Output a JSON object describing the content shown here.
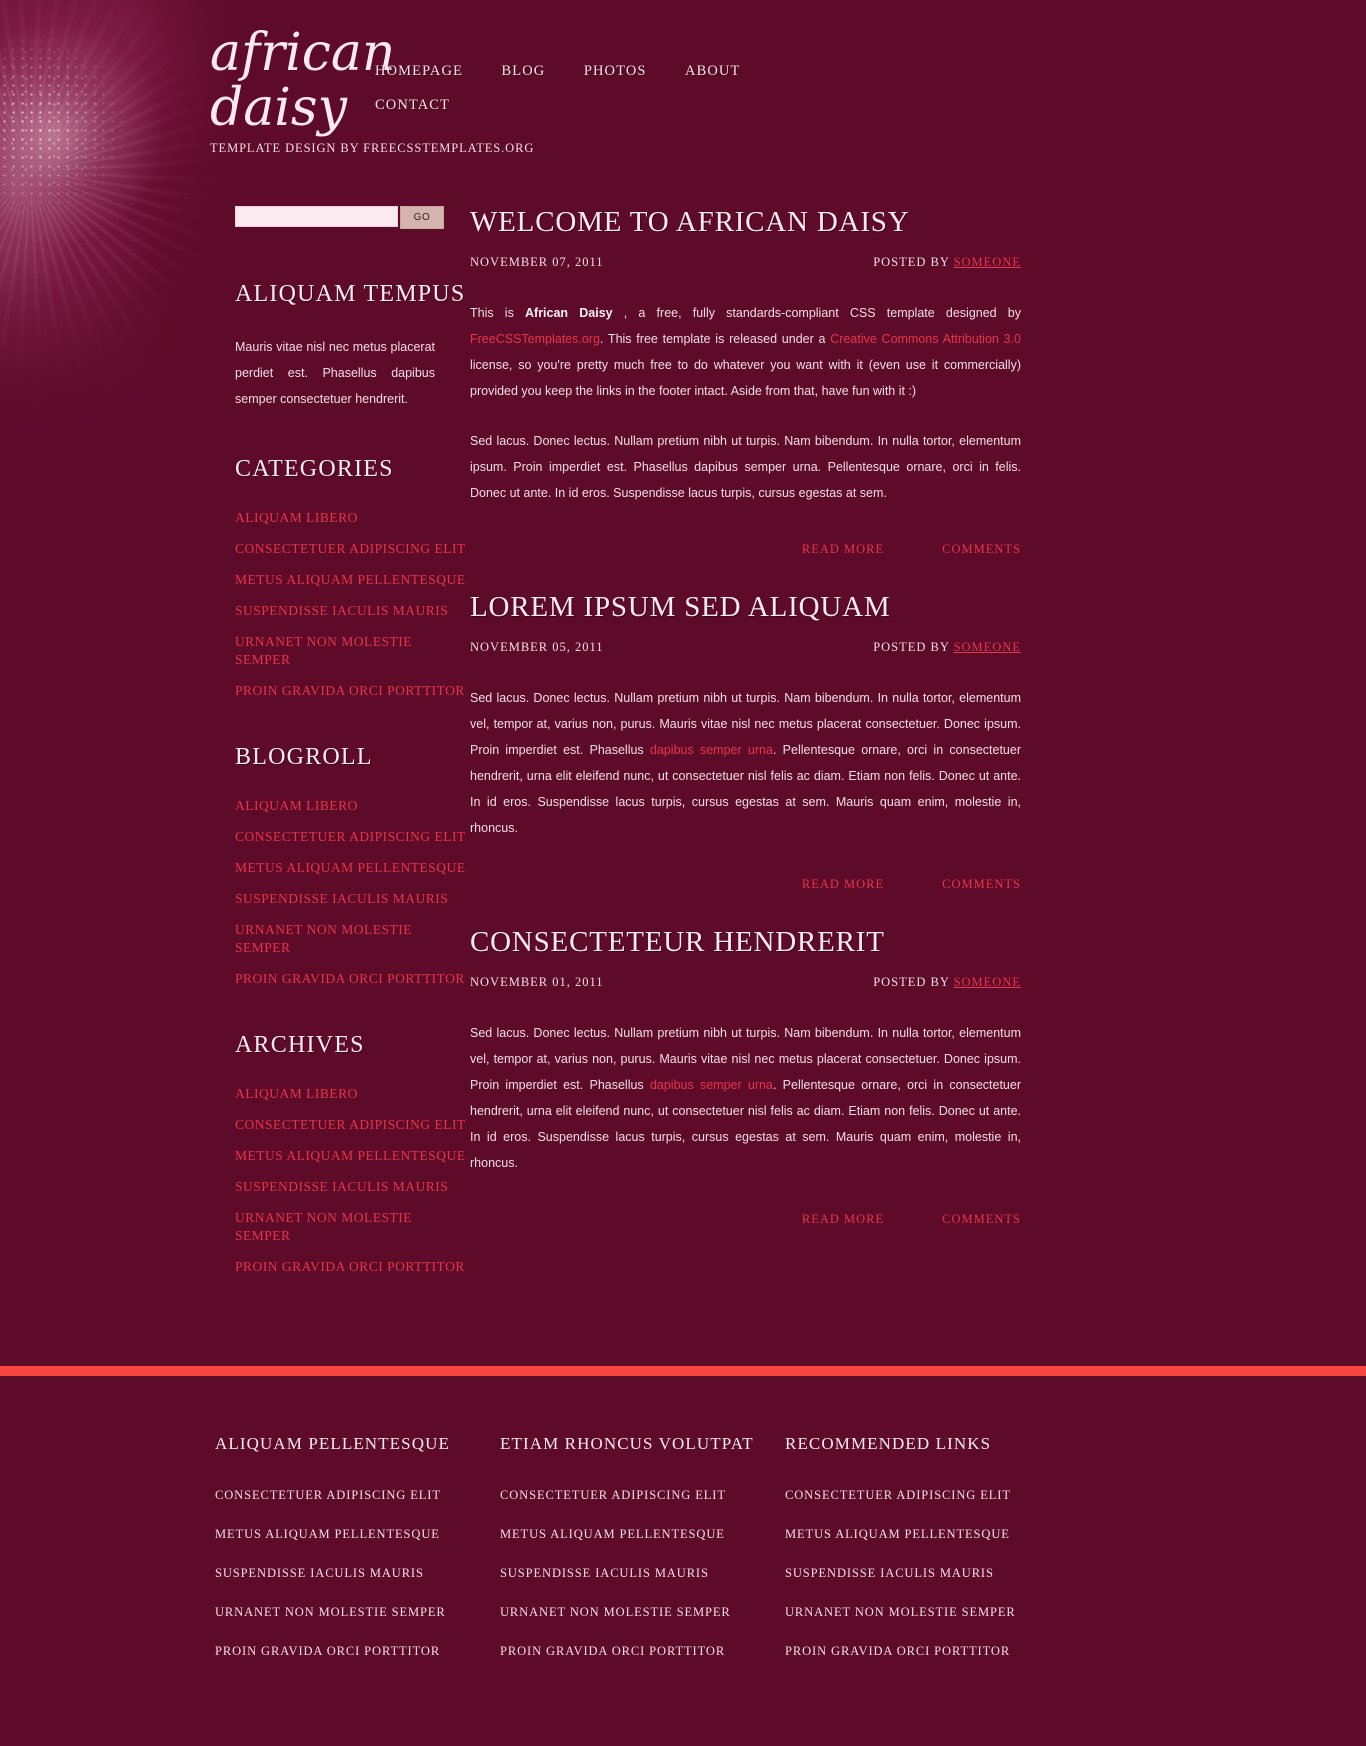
{
  "site": {
    "logo": "african daisy",
    "tagline": "Template design by FreeCSSTemplates.org",
    "accent_red": "#e8344a",
    "bg_maroon": "#5e0a29",
    "footer_bar": "#f9453f"
  },
  "nav": {
    "items": [
      {
        "label": "Homepage"
      },
      {
        "label": "Blog"
      },
      {
        "label": "Photos"
      },
      {
        "label": "About"
      },
      {
        "label": "Contact"
      }
    ]
  },
  "search": {
    "value": "",
    "placeholder": "",
    "button_label": "GO"
  },
  "sidebar": {
    "blocks": [
      {
        "title": "Aliquam Tempus",
        "text": "Mauris vitae nisl nec metus placerat perdiet est. Phasellus dapibus semper consectetuer hendrerit."
      },
      {
        "title": "Categories",
        "links": [
          "Aliquam libero",
          "Consectetuer adipiscing elit",
          "Metus aliquam pellentesque",
          "Suspendisse iaculis mauris",
          "Urnanet non molestie semper",
          "Proin gravida orci porttitor"
        ]
      },
      {
        "title": "Blogroll",
        "links": [
          "Aliquam libero",
          "Consectetuer adipiscing elit",
          "Metus aliquam pellentesque",
          "Suspendisse iaculis mauris",
          "Urnanet non molestie semper",
          "Proin gravida orci porttitor"
        ]
      },
      {
        "title": "Archives",
        "links": [
          "Aliquam libero",
          "Consectetuer adipiscing elit",
          "Metus aliquam pellentesque",
          "Suspendisse iaculis mauris",
          "Urnanet non molestie semper",
          "Proin gravida orci porttitor"
        ]
      }
    ]
  },
  "posts": [
    {
      "title": "Welcome to African Daisy",
      "date": "November 07, 2011",
      "posted_by_label": "Posted by",
      "author": "Someone",
      "para1_a": "This is ",
      "para1_strong": "African Daisy",
      "para1_b": " , a free, fully standards-compliant CSS template designed by ",
      "para1_link1": "FreeCSSTemplates.org",
      "para1_c": ". This free template is released under a ",
      "para1_link2": "Creative Commons Attribution 3.0",
      "para1_d": " license, so you're pretty much free to do whatever you want with it (even use it commercially) provided you keep the links in the footer intact. Aside from that, have fun with it :)",
      "para2": "Sed lacus. Donec lectus. Nullam pretium nibh ut turpis. Nam bibendum. In nulla tortor, elementum ipsum. Proin imperdiet est. Phasellus dapibus semper urna. Pellentesque ornare, orci in felis. Donec ut ante. In id eros. Suspendisse lacus turpis, cursus egestas at sem.",
      "read_more": "Read more",
      "comments": "Comments"
    },
    {
      "title": "Lorem Ipsum Sed Aliquam",
      "date": "November 05, 2011",
      "posted_by_label": "Posted by",
      "author": "Someone",
      "body_a": "Sed lacus. Donec lectus. Nullam pretium nibh ut turpis. Nam bibendum. In nulla tortor, elementum vel, tempor at, varius non, purus. Mauris vitae nisl nec metus placerat consectetuer. Donec ipsum. Proin imperdiet est. Phasellus ",
      "body_link": "dapibus semper urna",
      "body_b": ". Pellentesque ornare, orci in consectetuer hendrerit, urna elit eleifend nunc, ut consectetuer nisl felis ac diam. Etiam non felis. Donec ut ante. In id eros. Suspendisse lacus turpis, cursus egestas at sem. Mauris quam enim, molestie in, rhoncus.",
      "read_more": "Read more",
      "comments": "Comments"
    },
    {
      "title": "Consecteteur Hendrerit",
      "date": "November 01, 2011",
      "posted_by_label": "Posted by",
      "author": "Someone",
      "body_a": "Sed lacus. Donec lectus. Nullam pretium nibh ut turpis. Nam bibendum. In nulla tortor, elementum vel, tempor at, varius non, purus. Mauris vitae nisl nec metus placerat consectetuer. Donec ipsum. Proin imperdiet est. Phasellus ",
      "body_link": "dapibus semper urna",
      "body_b": ". Pellentesque ornare, orci in consectetuer hendrerit, urna elit eleifend nunc, ut consectetuer nisl felis ac diam. Etiam non felis. Donec ut ante. In id eros. Suspendisse lacus turpis, cursus egestas at sem. Mauris quam enim, molestie in, rhoncus.",
      "read_more": "Read more",
      "comments": "Comments"
    }
  ],
  "footer": {
    "columns": [
      {
        "title": "Aliquam Pellentesque",
        "links": [
          "Consectetuer adipiscing elit",
          "Metus aliquam pellentesque",
          "Suspendisse iaculis mauris",
          "Urnanet non molestie semper",
          "Proin gravida orci porttitor"
        ]
      },
      {
        "title": "Etiam Rhoncus Volutpat",
        "links": [
          "Consectetuer adipiscing elit",
          "Metus aliquam pellentesque",
          "Suspendisse iaculis mauris",
          "Urnanet non molestie semper",
          "Proin gravida orci porttitor"
        ]
      },
      {
        "title": "Recommended Links",
        "links": [
          "Consectetuer adipiscing elit",
          "Metus aliquam pellentesque",
          "Suspendisse iaculis mauris",
          "Urnanet non molestie semper",
          "Proin gravida orci porttitor"
        ]
      }
    ]
  }
}
